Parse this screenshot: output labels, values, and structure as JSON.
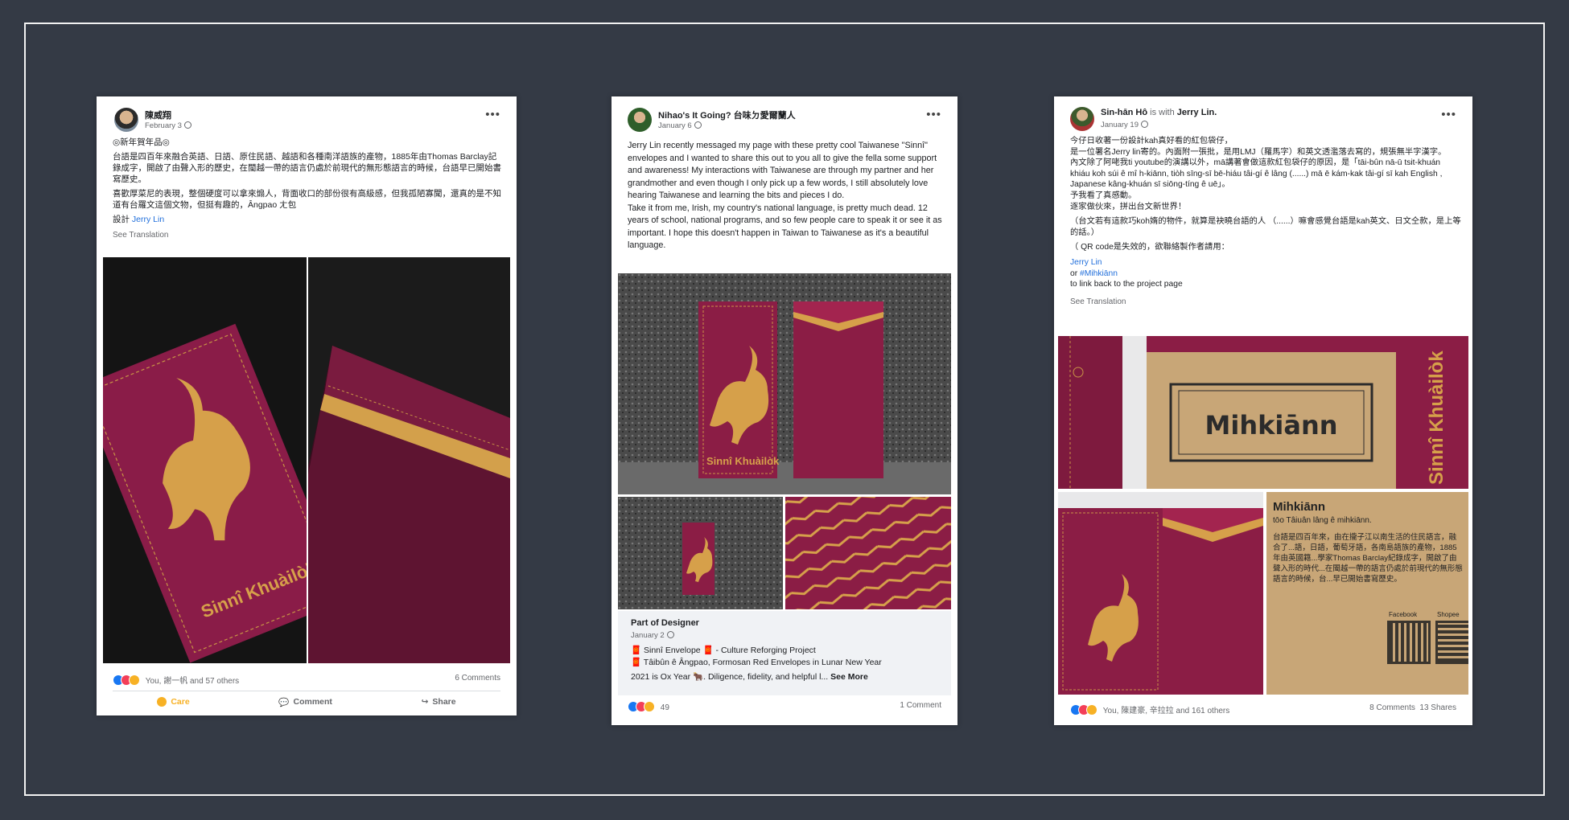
{
  "post1": {
    "author": "陳威翔",
    "date": "February 3",
    "lines": [
      "◎新年賀年品◎",
      "台語是四百年來融合英語、日語、原住民語、越語和各種南洋語族的產物，1885年由Thomas Barclay記錄成字，開啟了由聲入形的歷史，在閩越一帶的語言仍處於前現代的無形態語言的時候，台語早已開始書寫歷史。",
      "喜歡厚菜尼的表現，整個硬度可以拿來煽人，背面收口的部份很有高級感，但我孤陋寡聞，還真的是不知道有台羅文這個文物，但挺有趣的，Ângpao ㄤ包"
    ],
    "design_label": "設計",
    "design_link": "Jerry Lin",
    "see_translation": "See Translation",
    "reactions_text": "You, 謝一帆 and 57 others",
    "comments": "6 Comments",
    "care": "Care",
    "comment": "Comment",
    "share": "Share",
    "envelope_text": "Sinnî Khuàilòk"
  },
  "post2": {
    "author": "Nihao's It Going? 台味ㄉ愛爾蘭人",
    "date": "January 6",
    "text": "Jerry Lin recently messaged my page with these pretty cool Taiwanese \"Sinnî\" envelopes and I wanted to share this out to you all to give the fella some support and awareness! My interactions with Taiwanese are through my partner and her grandmother and even though I only pick up a few words, I still absolutely love hearing Taiwanese and learning the bits and pieces I do.\nTake it from me, Irish, my country's national language, is pretty much dead. 12 years of school, national programs, and so few people care to speak it or see it as important. I hope this doesn't happen in Taiwan to Taiwanese as it's a beautiful language.",
    "envelope_text": "Sinnî Khuàilòk",
    "preview_title": "Part of Designer",
    "preview_date": "January 2",
    "preview_line1": "🧧 Sinnî Envelope 🧧 - Culture Reforging Project",
    "preview_line2": "🧧 Tâibûn ê Ângpao, Formosan Red Envelopes in Lunar New Year",
    "preview_line3": "2021 is Ox Year 🐂. Diligence, fidelity, and helpful l...",
    "see_more": "See More",
    "reactions_count": "49",
    "comments": "1 Comment"
  },
  "post3": {
    "author": "Sin-hān Hô",
    "with_text": "is with",
    "with_name": "Jerry Lin.",
    "date": "January 19",
    "lines": [
      "今仔日收著一份設計kah真好看的紅包袋仔，",
      "是一位署名Jerry lin寄的。內面附一張批，是用LMJ（羅馬字）和英文透濫落去寫的，規張無半字漢字。",
      "內文除了阿咾我ti youtube的演講以外，mā講著會做這款紅包袋仔的原因，是「tāi-bûn nā-ū tsit-khuán khiáu koh súi ê mî h-kiānn, tiòh sīng-sī bē-hiáu tâi-gí ê lâng (......) mā ē kám-kak tâi-gí sī kah English , Japanese kâng-khuán sī siōng-tíng ê uē」。",
      "予我看了真感動。",
      "逐家做伙來，拼出台文新世界！",
      "（台文若有這款巧koh媠的物件，就算是袂曉台語的人 （......）嘛會感覺台語是kah英文、日文仝款，是上等的話。）",
      "（ QR code是失效的，欲聯絡製作者請用："
    ],
    "link1": "Jerry Lin",
    "link2_prefix": "or",
    "link2": "#Mihkiānn",
    "link3": "to link back to the project page",
    "see_translation": "See Translation",
    "box_title": "Mihkiānn",
    "card_title": "Mihkiānn",
    "card_sub": "tōo Tâiuân lâng ê mihkiānn.",
    "card_body": "台語是四百年來，由在攏子江以南生活的住民語言，融合了...語，日語，葡萄牙語，各南島語族的產物，1885年由英國籍...學家Thomas Barclay紀錄成字，開啟了由聲入形的時代...在閩越一帶的語言仍處於前現代的無形態語言的時候，台...早已開始書寫歷史。",
    "qr1_label": "Facebook",
    "qr2_label": "Shopee",
    "envelope_text": "Sinnî Khuàilòk",
    "reactions_text": "You, 陳建豪, 辛拉拉 and 161 others",
    "comments": "8 Comments",
    "shares": "13 Shares"
  }
}
